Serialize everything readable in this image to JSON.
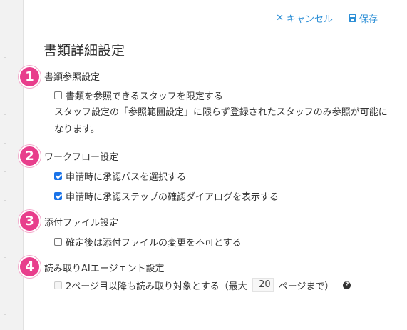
{
  "topbar": {
    "cancel_label": "キャンセル",
    "save_label": "保存"
  },
  "page_title": "書類詳細設定",
  "sections": [
    {
      "badge": "1",
      "title": "書類参照設定",
      "options": [
        {
          "label": "書類を参照できるスタッフを限定する",
          "checked": false,
          "disabled": false
        }
      ],
      "description": "スタッフ設定の「参照範囲設定」に限らず登録されたスタッフのみ参照が可能になります。"
    },
    {
      "badge": "2",
      "title": "ワークフロー設定",
      "options": [
        {
          "label": "申請時に承認パスを選択する",
          "checked": true,
          "disabled": false
        },
        {
          "label": "申請時に承認ステップの確認ダイアログを表示する",
          "checked": true,
          "disabled": false
        }
      ]
    },
    {
      "badge": "3",
      "title": "添付ファイル設定",
      "options": [
        {
          "label": "確定後は添付ファイルの変更を不可とする",
          "checked": false,
          "disabled": false
        }
      ]
    },
    {
      "badge": "4",
      "title": "読み取りAIエージェント設定",
      "options": [
        {
          "label_before": "2ページ目以降も読み取り対象とする（最大",
          "value": "20",
          "label_after": "ページまで）",
          "checked": false,
          "disabled": true
        }
      ]
    }
  ],
  "colors": {
    "link": "#2d8fd6",
    "badge": "#e83e8c",
    "checkbox_checked": "#1a73e8"
  }
}
